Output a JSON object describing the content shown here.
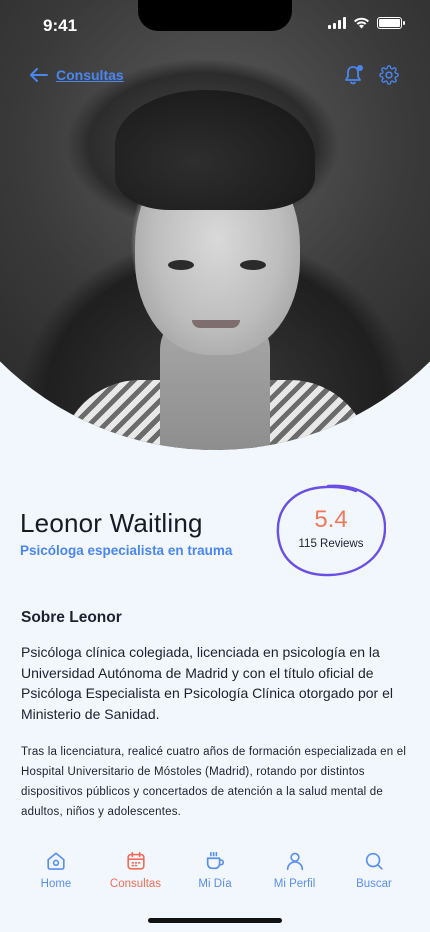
{
  "status": {
    "time": "9:41"
  },
  "nav": {
    "back_label": "Consultas"
  },
  "profile": {
    "name": "Leonor Waitling",
    "role": "Psicóloga especialista en trauma",
    "rating": "5.4",
    "reviews": "115 Reviews"
  },
  "about": {
    "title": "Sobre Leonor",
    "paragraph1": "Psicóloga clínica colegiada, licenciada en psicología en la Universidad Autónoma de Madrid y con el título oficial de Psicóloga Especialista en Psicología Clínica otorgado por el Ministerio de Sanidad.",
    "paragraph2": "Tras la licenciatura, realicé cuatro años de formación especializada en el Hospital Universitario de Móstoles (Madrid), rotando por distintos dispositivos públicos y concertados de atención a la salud mental de adultos, niños y adolescentes."
  },
  "tabs": [
    {
      "label": "Home",
      "icon": "home-icon"
    },
    {
      "label": "Consultas",
      "icon": "calendar-icon"
    },
    {
      "label": "Mi Día",
      "icon": "cup-icon"
    },
    {
      "label": "Mi Perfil",
      "icon": "user-icon"
    },
    {
      "label": "Buscar",
      "icon": "search-icon"
    }
  ],
  "colors": {
    "accent": "#4a86f0",
    "active_tab": "#ef6e58",
    "rating": "#ef7a5a",
    "highlight_circle": "#6a4fe6"
  }
}
